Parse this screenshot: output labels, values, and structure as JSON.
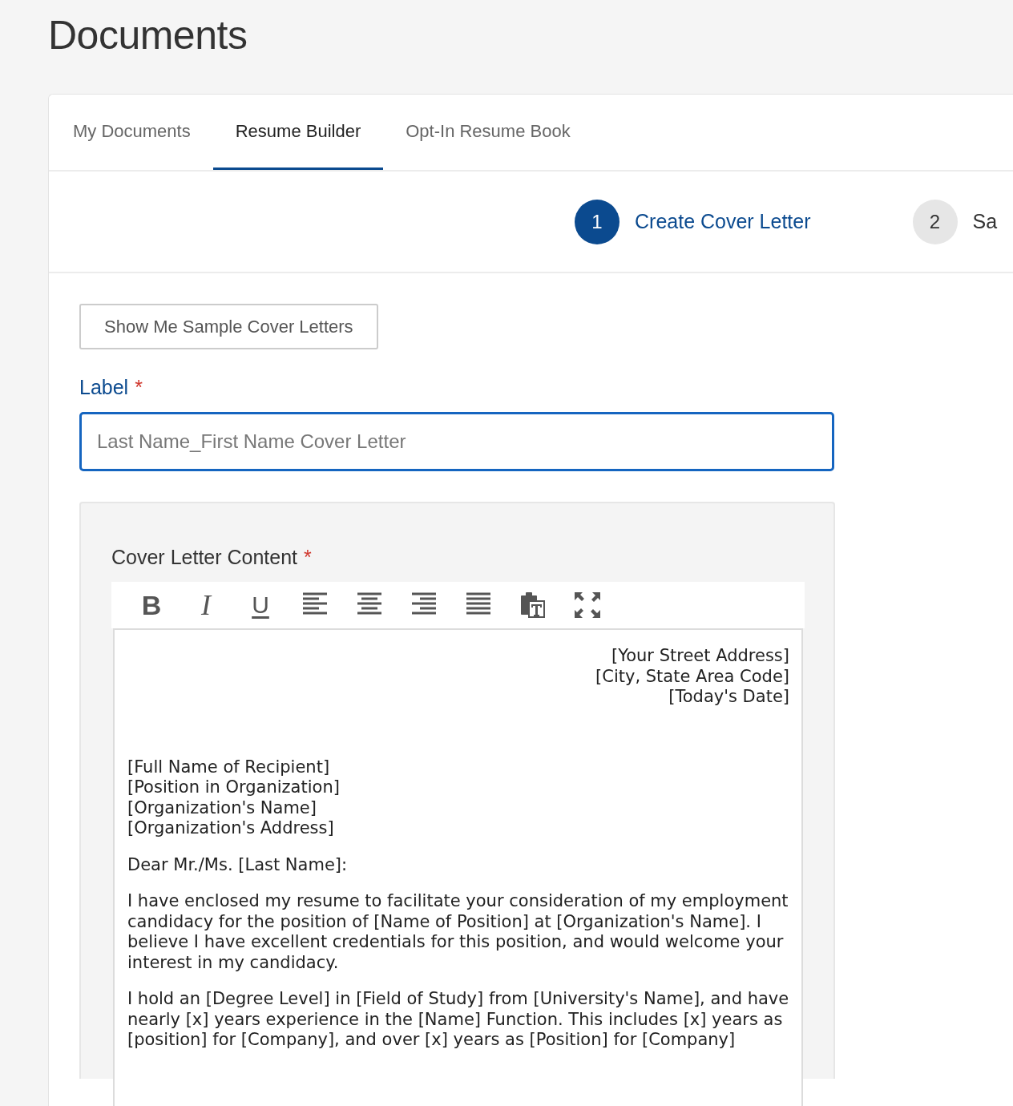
{
  "page": {
    "title": "Documents"
  },
  "tabs": [
    {
      "label": "My Documents",
      "selected": false
    },
    {
      "label": "Resume Builder",
      "selected": true
    },
    {
      "label": "Opt-In Resume Book",
      "selected": false
    }
  ],
  "steps": [
    {
      "number": "1",
      "label": "Create Cover Letter",
      "selected": true
    },
    {
      "number": "2",
      "label": "Sa",
      "selected": false
    }
  ],
  "sample_button": "Show Me Sample Cover Letters",
  "label_field": {
    "label": "Label",
    "required_mark": "*",
    "placeholder": "Last Name_First Name Cover Letter",
    "focused": true
  },
  "editor": {
    "label": "Cover Letter Content",
    "required_mark": "*",
    "toolbar": [
      {
        "kind": "bold",
        "glyph": "B"
      },
      {
        "kind": "italic",
        "glyph": "I"
      },
      {
        "kind": "underline",
        "glyph": "U"
      },
      {
        "kind": "align-left"
      },
      {
        "kind": "align-center"
      },
      {
        "kind": "align-right"
      },
      {
        "kind": "justify"
      },
      {
        "kind": "paste-text"
      },
      {
        "kind": "fullscreen"
      }
    ],
    "address_lines": [
      "[Your Street Address]",
      "[City, State Area Code]",
      "[Today's Date]"
    ],
    "recipient_lines": [
      "[Full Name of Recipient]",
      "[Position in Organization]",
      "[Organization's Name]",
      "[Organization's Address]"
    ],
    "paragraphs": [
      "Dear Mr./Ms. [Last Name]:",
      "I have enclosed my resume to facilitate your consideration of my employment candidacy for the position of [Name of Position] at [Organization's Name]. I believe I have excellent credentials for this position, and would welcome your interest in my candidacy.",
      "I hold an [Degree Level] in [Field of Study] from [University's Name], and have nearly [x] years experience in the [Name] Function. This includes [x] years as [position] for [Company], and over [x] years as [Position] for [Company]"
    ]
  }
}
